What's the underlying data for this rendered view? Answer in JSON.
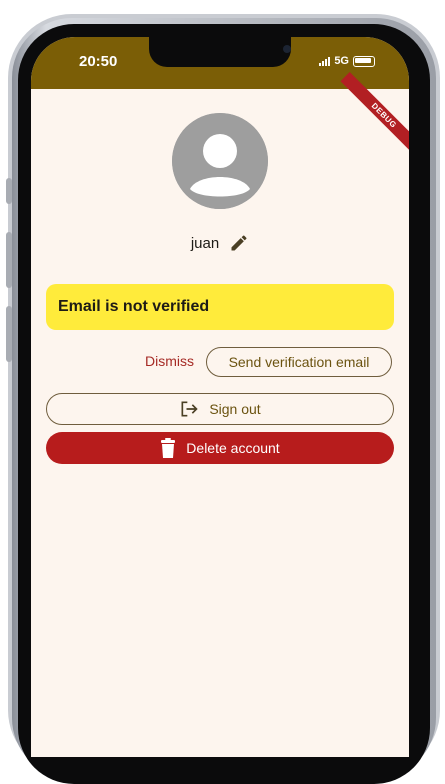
{
  "status_bar": {
    "time": "20:50",
    "network": "5G"
  },
  "debug_banner": "DEBUG",
  "profile": {
    "username": "juan"
  },
  "verification_banner": {
    "text": "Email is not verified"
  },
  "actions": {
    "dismiss_label": "Dismiss",
    "send_verification_label": "Send verification email",
    "sign_out_label": "Sign out",
    "delete_account_label": "Delete account"
  },
  "icons": {
    "edit": "pencil-icon",
    "sign_out": "logout-icon",
    "delete": "trash-icon",
    "avatar": "person-icon"
  },
  "colors": {
    "app_bar": "#7b5e06",
    "background": "#fdf5ee",
    "banner": "#ffeb3b",
    "danger": "#b71c1c",
    "dismiss": "#a52a25"
  }
}
